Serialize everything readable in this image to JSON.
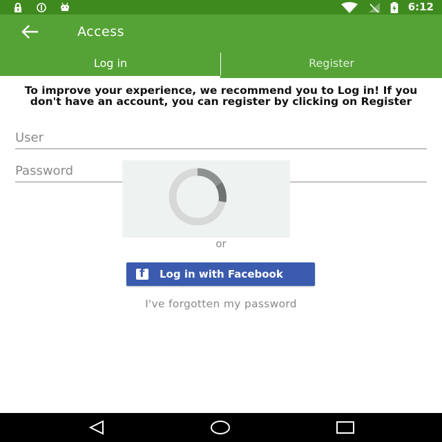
{
  "status_bar": {
    "time": "6:12",
    "icons_left": [
      "lock-icon",
      "sync-icon",
      "android-icon"
    ],
    "icons_right": [
      "wifi-icon",
      "signal-icon",
      "battery-charging-icon"
    ]
  },
  "app_bar": {
    "title": "Access",
    "back_icon": "arrow-back-icon",
    "color": "#55a336"
  },
  "tabs": [
    {
      "label": "Log in",
      "selected": true
    },
    {
      "label": "Register",
      "selected": false
    }
  ],
  "intro_text": "To improve your experience, we recommend you to Log in! If you don't have an account, you can register by clicking on Register",
  "form": {
    "user_placeholder": "User",
    "user_value": "",
    "password_placeholder": "Password",
    "password_value": ""
  },
  "or_text": "or",
  "facebook_button": {
    "label": "Log in with Facebook",
    "icon": "facebook-icon",
    "color": "#3b5bae"
  },
  "forgot_password": "I've forgotten my password",
  "nav_bar": {
    "buttons": [
      "back-triangle-icon",
      "home-circle-icon",
      "recents-square-icon"
    ]
  }
}
